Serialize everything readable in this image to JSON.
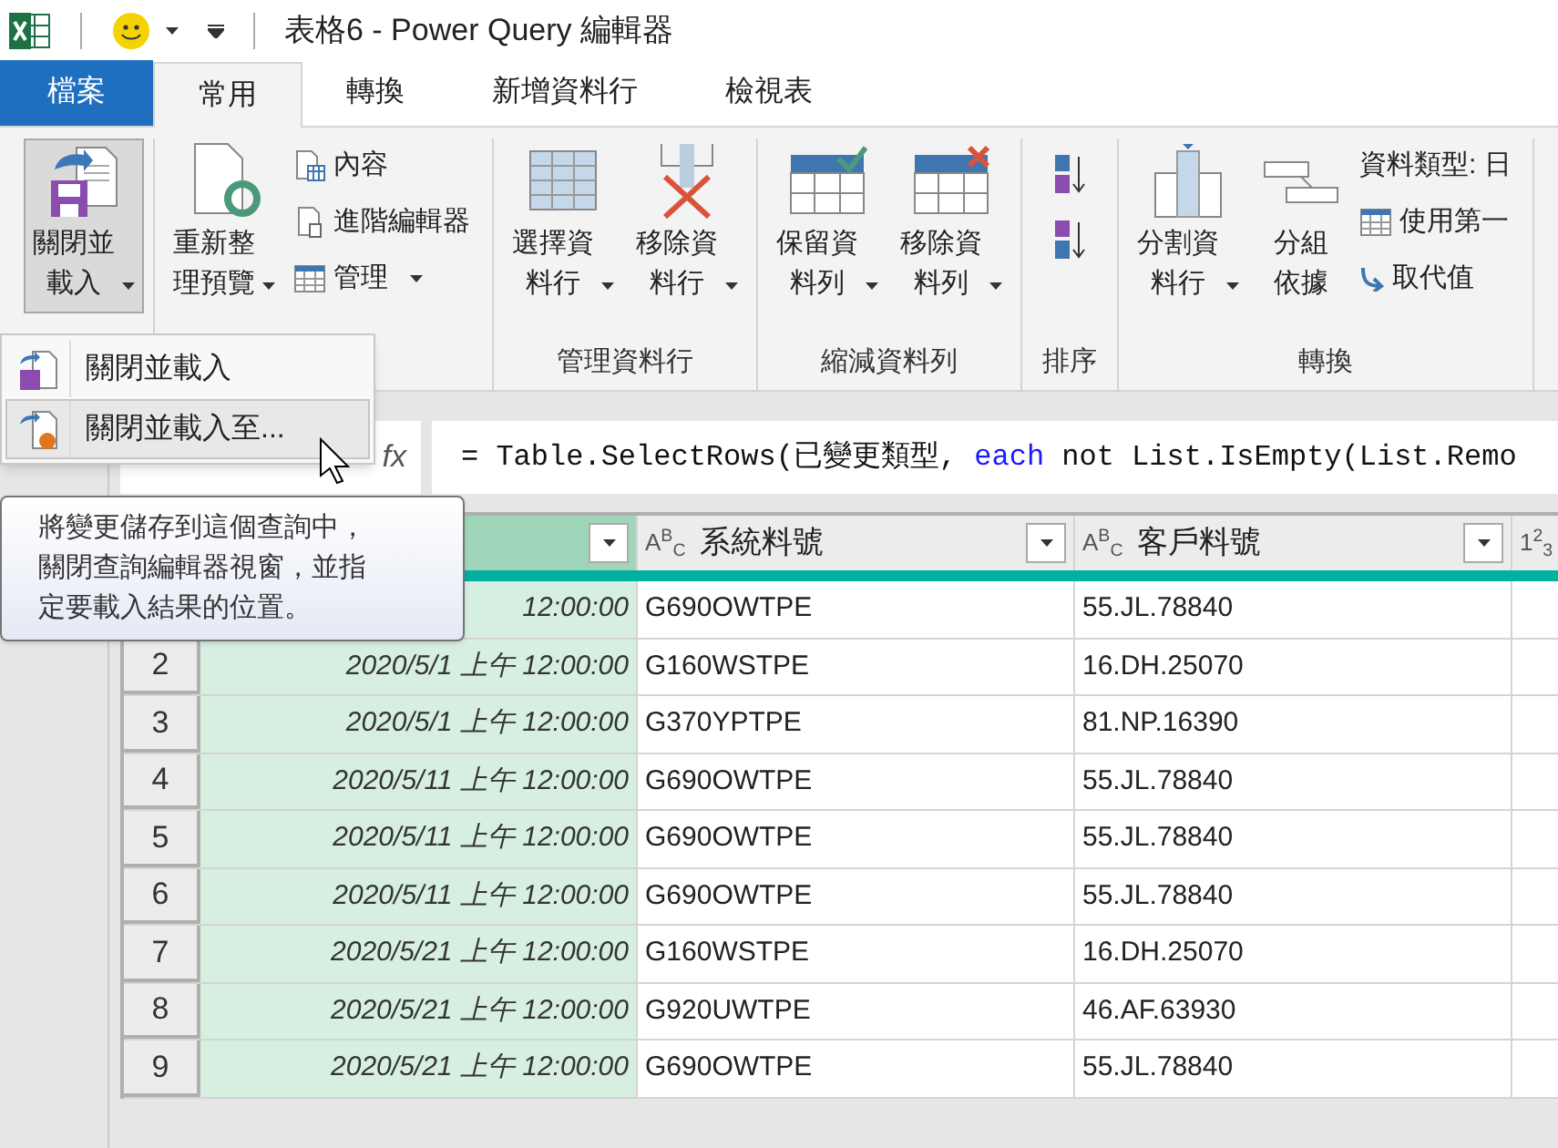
{
  "window": {
    "title": "表格6 - Power Query 編輯器"
  },
  "tabs": [
    {
      "label": "檔案",
      "kind": "file",
      "selected": false
    },
    {
      "label": "常用",
      "kind": "tab",
      "selected": true
    },
    {
      "label": "轉換",
      "kind": "tab",
      "selected": false
    },
    {
      "label": "新增資料行",
      "kind": "tab",
      "selected": false
    },
    {
      "label": "檢視表",
      "kind": "tab",
      "selected": false
    }
  ],
  "ribbon": {
    "groups": [
      {
        "items": [
          {
            "kind": "big",
            "lines": [
              "關閉並",
              "載入"
            ],
            "has_menu": true,
            "pressed": true
          }
        ]
      },
      {
        "items": [
          {
            "kind": "big",
            "lines": [
              "重新整",
              "理預覽"
            ],
            "has_menu": true,
            "pressed": false
          },
          {
            "kind": "stack",
            "entries": [
              {
                "label": "內容",
                "has_menu": false
              },
              {
                "label": "進階編輯器",
                "has_menu": false
              },
              {
                "label": "管理",
                "has_menu": true
              }
            ]
          }
        ]
      },
      {
        "label": "管理資料行",
        "items": [
          {
            "kind": "big",
            "lines": [
              "選擇資",
              "料行"
            ],
            "has_menu": true,
            "pressed": false
          },
          {
            "kind": "big",
            "lines": [
              "移除資",
              "料行"
            ],
            "has_menu": true,
            "pressed": false
          }
        ]
      },
      {
        "label": "縮減資料列",
        "items": [
          {
            "kind": "big",
            "lines": [
              "保留資",
              "料列"
            ],
            "has_menu": true,
            "pressed": false
          },
          {
            "kind": "big",
            "lines": [
              "移除資",
              "料列"
            ],
            "has_menu": true,
            "pressed": false
          }
        ]
      },
      {
        "label": "排序",
        "items": [
          {
            "kind": "sort"
          }
        ]
      },
      {
        "label": "轉換",
        "items": [
          {
            "kind": "big",
            "lines": [
              "分割資",
              "料行"
            ],
            "has_menu": true,
            "pressed": false
          },
          {
            "kind": "big",
            "lines": [
              "分組",
              "依據"
            ],
            "has_menu": false,
            "pressed": false
          },
          {
            "kind": "stack",
            "entries": [
              {
                "label": "資料類型: 日",
                "has_menu": false
              },
              {
                "label": "使用第一",
                "has_menu": false
              },
              {
                "label": "取代值",
                "has_menu": false
              }
            ]
          }
        ]
      }
    ]
  },
  "menu": [
    {
      "label": "關閉並載入",
      "selected": false
    },
    {
      "label": "關閉並載入至...",
      "selected": true
    }
  ],
  "tooltip": "將變更儲存到這個查詢中，關閉查詢編輯器視窗，並指定要載入結果的位置。",
  "formula_bar": {
    "fx": "fx",
    "segments": [
      {
        "text": "= Table.SelectRows(已變更類型, ",
        "kind": "plain"
      },
      {
        "text": "each",
        "kind": "keyword"
      },
      {
        "text": " not List.IsEmpty(List.Remo",
        "kind": "plain"
      }
    ]
  },
  "table": {
    "columns": [
      {
        "selected": true
      },
      {
        "type_label": "A$^{B}$$_{C}$",
        "name": "系統料號",
        "selected": false
      },
      {
        "type_label": "A$^{B}$$_{C}$",
        "name": "客戶料號",
        "selected": false
      },
      {
        "type_label": "1$^{2}$$_{3}$",
        "selected": false
      }
    ],
    "rows": [
      {
        "cells": [
          "12:00:00",
          "G690OWTPE",
          "55.JL.78840"
        ]
      },
      {
        "number": "2",
        "cells": [
          "2020/5/1 上午 12:00:00",
          "G160WSTPE",
          "16.DH.25070"
        ]
      },
      {
        "number": "3",
        "cells": [
          "2020/5/1 上午 12:00:00",
          "G370YPTPE",
          "81.NP.16390"
        ]
      },
      {
        "number": "4",
        "cells": [
          "2020/5/11 上午 12:00:00",
          "G690OWTPE",
          "55.JL.78840"
        ]
      },
      {
        "number": "5",
        "cells": [
          "2020/5/11 上午 12:00:00",
          "G690OWTPE",
          "55.JL.78840"
        ]
      },
      {
        "number": "6",
        "cells": [
          "2020/5/11 上午 12:00:00",
          "G690OWTPE",
          "55.JL.78840"
        ]
      },
      {
        "number": "7",
        "cells": [
          "2020/5/21 上午 12:00:00",
          "G160WSTPE",
          "16.DH.25070"
        ]
      },
      {
        "number": "8",
        "cells": [
          "2020/5/21 上午 12:00:00",
          "G920UWTPE",
          "46.AF.63930"
        ]
      },
      {
        "number": "9",
        "cells": [
          "2020/5/21 上午 12:00:00",
          "G690OWTPE",
          "55.JL.78840"
        ]
      }
    ]
  }
}
